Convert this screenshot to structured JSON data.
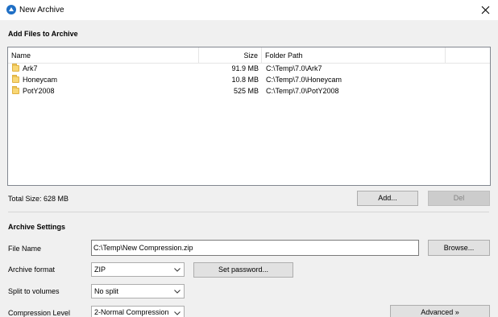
{
  "window": {
    "title": "New Archive"
  },
  "add_files": {
    "heading": "Add Files to Archive",
    "columns": {
      "name": "Name",
      "size": "Size",
      "folder_path": "Folder Path"
    },
    "rows": [
      {
        "name": "Ark7",
        "size": "91.9 MB",
        "folder_path": "C:\\Temp\\7.0\\Ark7"
      },
      {
        "name": "Honeycam",
        "size": "10.8 MB",
        "folder_path": "C:\\Temp\\7.0\\Honeycam"
      },
      {
        "name": "PotY2008",
        "size": "525 MB",
        "folder_path": "C:\\Temp\\7.0\\PotY2008"
      }
    ],
    "total_size": "Total Size: 628 MB",
    "add_button": "Add...",
    "del_button": "Del"
  },
  "archive_settings": {
    "heading": "Archive Settings",
    "file_name_label": "File Name",
    "file_name_value": "C:\\Temp\\New Compression.zip",
    "browse_button": "Browse...",
    "format_label": "Archive format",
    "format_value": "ZIP",
    "set_password_button": "Set password...",
    "split_label": "Split to volumes",
    "split_value": "No split",
    "compression_label": "Compression Level",
    "compression_value": "2-Normal Compression",
    "advanced_button": "Advanced »"
  },
  "colors": {
    "app_icon": "#1f6fc5",
    "folder": "#f8d775"
  }
}
